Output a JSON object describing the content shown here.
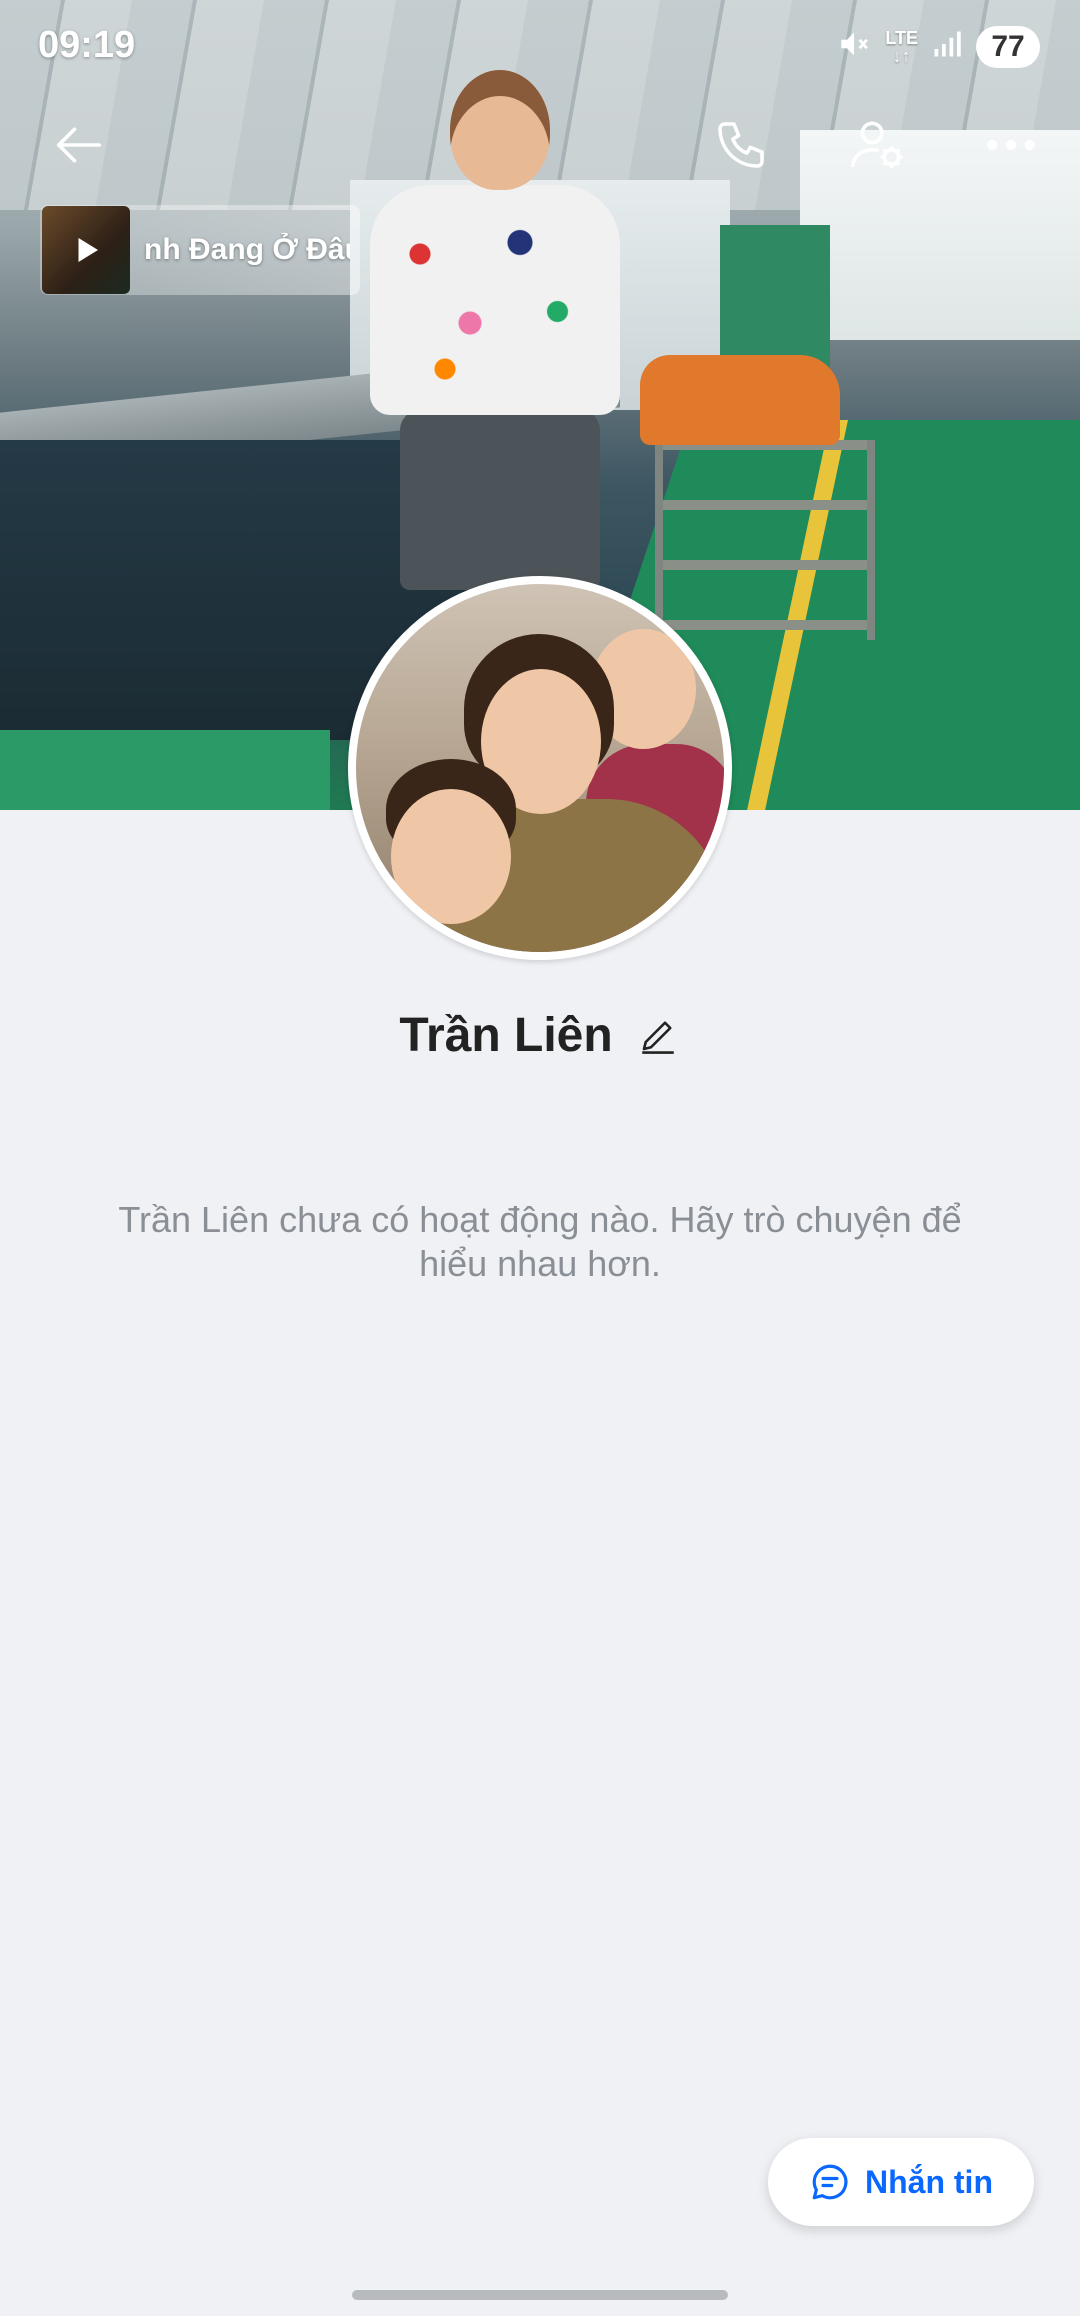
{
  "status_bar": {
    "time": "09:19",
    "network": "LTE",
    "battery": "77",
    "icons": [
      "mute-icon",
      "lte-icon",
      "signal-icon",
      "battery-icon"
    ]
  },
  "nav": {
    "icons": [
      "back-arrow-icon",
      "phone-icon",
      "user-settings-icon",
      "more-icon"
    ]
  },
  "music": {
    "title": "nh Đang Ở Đâu",
    "icon": "play-icon"
  },
  "profile": {
    "name": "Trần Liên",
    "edit_icon": "pencil-icon"
  },
  "empty_state": {
    "message": "Trần Liên chưa có hoạt động nào. Hãy trò chuyện để hiểu nhau hơn."
  },
  "actions": {
    "message_label": "Nhắn tin",
    "message_icon": "chat-bubble-icon"
  },
  "colors": {
    "accent": "#0a68ff",
    "background": "#eff1f5",
    "text_primary": "#222222",
    "text_secondary": "#8a8f96"
  }
}
